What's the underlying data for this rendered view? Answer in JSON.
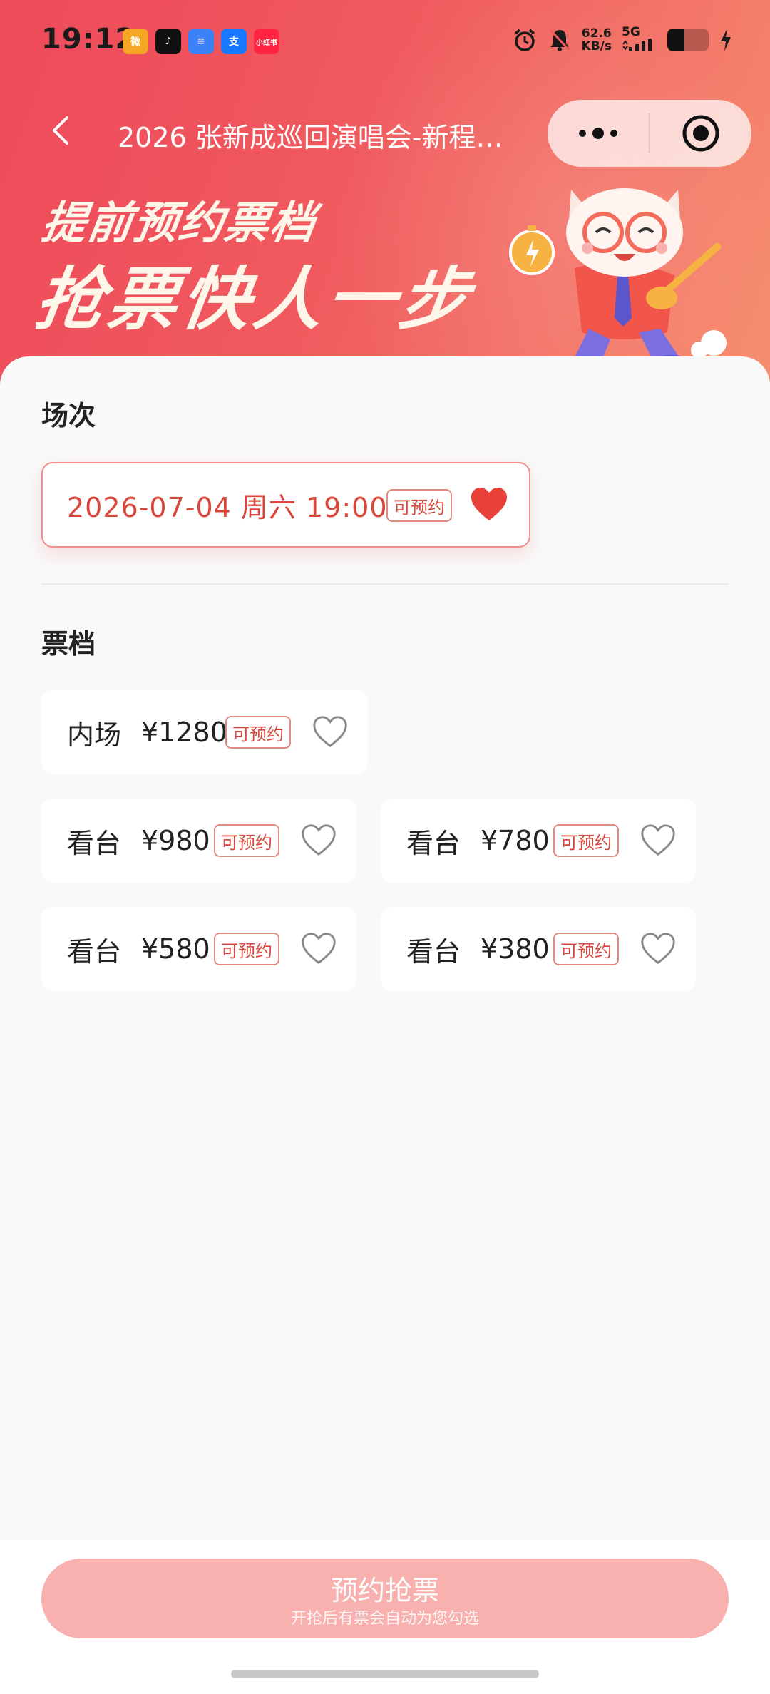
{
  "status_bar": {
    "time": "19:12",
    "apps": [
      {
        "icon": "weibo-icon",
        "glyph": "微",
        "color": "#f5a623"
      },
      {
        "icon": "tiktok-icon",
        "glyph": "♪",
        "color": "#111111"
      },
      {
        "icon": "message-icon",
        "glyph": "≡",
        "color": "#3b82f6"
      },
      {
        "icon": "alipay-icon",
        "glyph": "支",
        "color": "#1677ff"
      },
      {
        "icon": "xiaohongshu-icon",
        "glyph": "小红书",
        "color": "#ff2442"
      }
    ],
    "net_speed_value": "62.6",
    "net_speed_unit": "KB/s",
    "network": "5G"
  },
  "nav": {
    "title": "2026 张新成巡回演唱会-新程…"
  },
  "banner": {
    "line1": "提前预约票档",
    "line2": "抢票快人一步"
  },
  "sessions": {
    "title": "场次",
    "items": [
      {
        "label": "2026-07-04 周六 19:00",
        "badge": "可预约",
        "favorited": true
      }
    ]
  },
  "tiers": {
    "title": "票档",
    "items": [
      {
        "area": "内场",
        "price": "¥1280",
        "badge": "可预约",
        "favorited": false
      },
      {
        "area": "看台",
        "price": "¥980",
        "badge": "可预约",
        "favorited": false
      },
      {
        "area": "看台",
        "price": "¥780",
        "badge": "可预约",
        "favorited": false
      },
      {
        "area": "看台",
        "price": "¥580",
        "badge": "可预约",
        "favorited": false
      },
      {
        "area": "看台",
        "price": "¥380",
        "badge": "可预约",
        "favorited": false
      }
    ]
  },
  "cta": {
    "label": "预约抢票",
    "sub": "开抢后有票会自动为您勾选"
  },
  "colors": {
    "accent": "#d9463c",
    "header_gradient_start": "#ee4a5a",
    "header_gradient_end": "#f6906f",
    "cta_bg": "#f9b1b0"
  }
}
